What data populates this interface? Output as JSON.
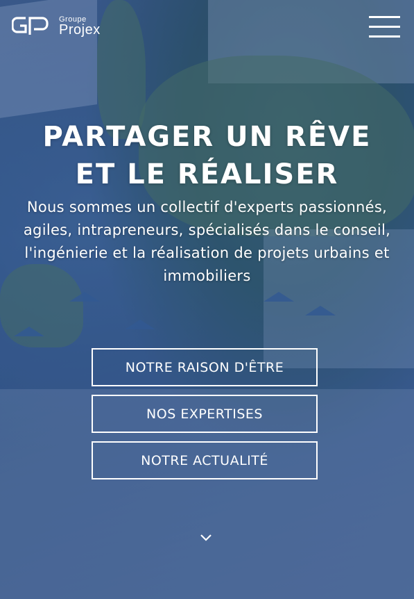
{
  "header": {
    "logo_small": "Groupe",
    "logo_big": "Projex",
    "menu_icon": "hamburger-menu-icon"
  },
  "hero": {
    "title_line1": "PARTAGER UN RÊVE",
    "title_line2": "ET LE RÉALISER",
    "subtitle": "Nous sommes un collectif d'experts passionnés, agiles, intrapreneurs, spécialisés dans le conseil, l'ingénierie et la réalisation de projets urbains et immobiliers"
  },
  "buttons": [
    {
      "label": "NOTRE RAISON D'ÊTRE"
    },
    {
      "label": "NOS EXPERTISES"
    },
    {
      "label": "NOTRE ACTUALITÉ"
    }
  ],
  "scroll_icon": "chevron-down-icon",
  "colors": {
    "overlay": "#234690",
    "text": "#ffffff"
  }
}
